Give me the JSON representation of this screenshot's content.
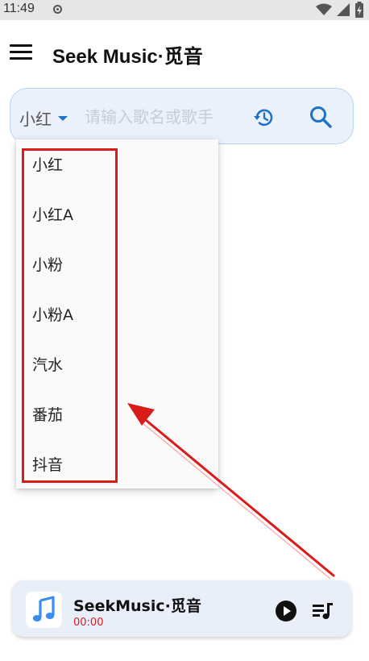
{
  "status_bar": {
    "time": "11:49",
    "icons": [
      "media-indicator-icon",
      "wifi-icon",
      "signal-icon",
      "battery-charging-icon"
    ]
  },
  "app_bar": {
    "title": "Seek Music·觅音",
    "menu_icon": "menu-icon"
  },
  "search": {
    "source_selected": "小红",
    "placeholder": "请输入歌名或歌手",
    "value": "",
    "history_icon": "history-icon",
    "search_icon": "search-icon"
  },
  "dropdown": {
    "options": [
      "小红",
      "小红A",
      "小粉",
      "小粉A",
      "汽水",
      "番茄",
      "抖音"
    ]
  },
  "player": {
    "track_title": "SeekMusic·觅音",
    "current_time": "00:00",
    "play_icon": "play-icon",
    "queue_icon": "queue-music-icon"
  },
  "colors": {
    "accent": "#1e73c9",
    "annotation_red": "#d91b1b",
    "search_bar_bg": "#eaf1fb",
    "player_bg": "#e9eff9"
  }
}
